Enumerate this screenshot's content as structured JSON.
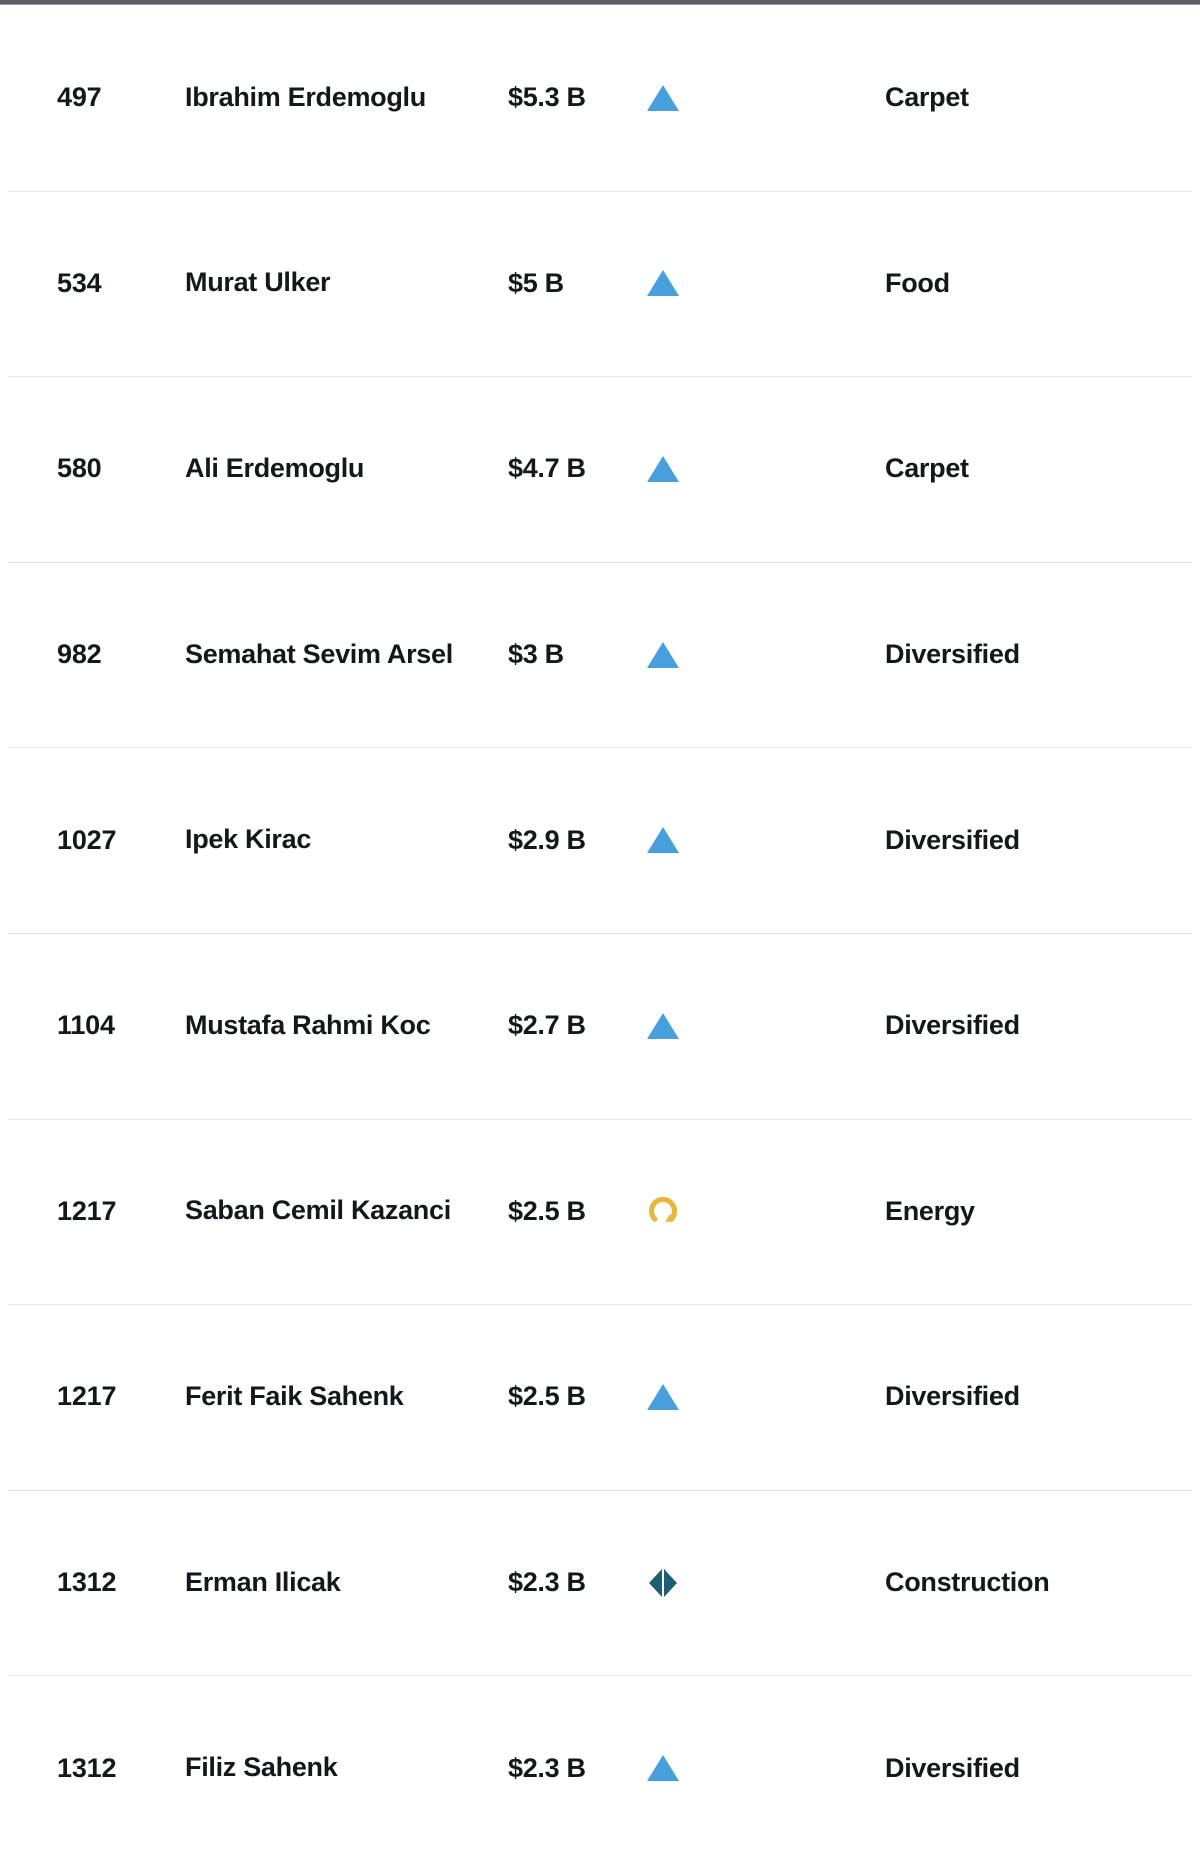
{
  "table": {
    "columns": [
      "rank",
      "name",
      "net_worth",
      "change",
      "industry"
    ],
    "colors": {
      "text": "#14181c",
      "row_divider": "#e3e5e8",
      "top_bar": "#5a5e63",
      "up_arrow": "#47a0dd",
      "no_change_gold": "#e7b83c",
      "steady_diamond": "#1b5e76",
      "page_background": "#ffffff"
    },
    "rows": [
      {
        "rank": "497",
        "name": "Ibrahim Erdemoglu",
        "net_worth": "$5.3 B",
        "change_icon": "up-triangle-icon",
        "industry": "Carpet"
      },
      {
        "rank": "534",
        "name": "Murat Ulker",
        "net_worth": "$5 B",
        "change_icon": "up-triangle-icon",
        "industry": "Food"
      },
      {
        "rank": "580",
        "name": "Ali Erdemoglu",
        "net_worth": "$4.7 B",
        "change_icon": "up-triangle-icon",
        "industry": "Carpet"
      },
      {
        "rank": "982",
        "name": "Semahat Sevim Arsel",
        "net_worth": "$3 B",
        "change_icon": "up-triangle-icon",
        "industry": "Diversified"
      },
      {
        "rank": "1027",
        "name": "Ipek Kirac",
        "net_worth": "$2.9 B",
        "change_icon": "up-triangle-icon",
        "industry": "Diversified"
      },
      {
        "rank": "1104",
        "name": "Mustafa Rahmi Koc",
        "net_worth": "$2.7 B",
        "change_icon": "up-triangle-icon",
        "industry": "Diversified"
      },
      {
        "rank": "1217",
        "name": "Saban Cemil Kazanci",
        "net_worth": "$2.5 B",
        "change_icon": "circular-arrow-icon",
        "industry": "Energy"
      },
      {
        "rank": "1217",
        "name": "Ferit Faik Sahenk",
        "net_worth": "$2.5 B",
        "change_icon": "up-triangle-icon",
        "industry": "Diversified"
      },
      {
        "rank": "1312",
        "name": "Erman Ilicak",
        "net_worth": "$2.3 B",
        "change_icon": "left-right-diamond-icon",
        "industry": "Construction"
      },
      {
        "rank": "1312",
        "name": "Filiz Sahenk",
        "net_worth": "$2.3 B",
        "change_icon": "up-triangle-icon",
        "industry": "Diversified"
      }
    ]
  }
}
